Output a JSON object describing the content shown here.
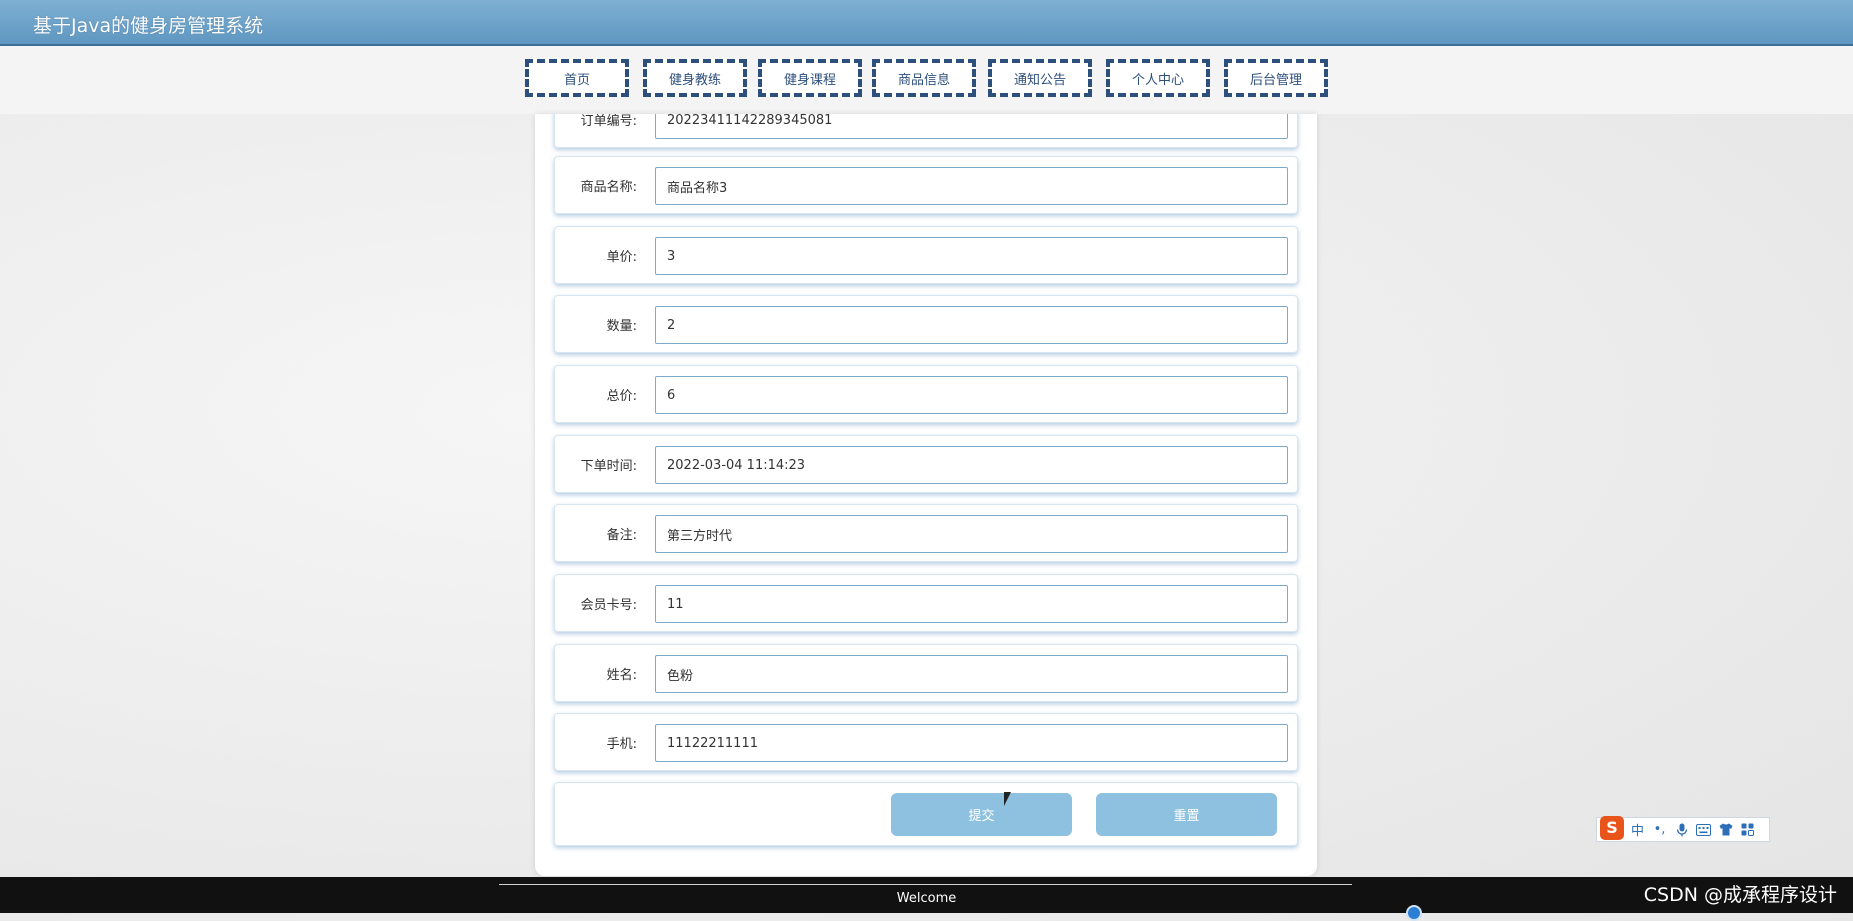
{
  "header": {
    "title": "基于Java的健身房管理系统"
  },
  "nav": {
    "items": [
      {
        "label": "首页"
      },
      {
        "label": "健身教练"
      },
      {
        "label": "健身课程"
      },
      {
        "label": "商品信息"
      },
      {
        "label": "通知公告"
      },
      {
        "label": "个人中心"
      },
      {
        "label": "后台管理"
      }
    ]
  },
  "form": {
    "fields": [
      {
        "label": "订单编号:",
        "value": "2022341114228934508​1"
      },
      {
        "label": "商品名称:",
        "value": "商品名称3"
      },
      {
        "label": "单价:",
        "value": "3"
      },
      {
        "label": "数量:",
        "value": "2"
      },
      {
        "label": "总价:",
        "value": "6"
      },
      {
        "label": "下单时间:",
        "value": "2022-03-04 11:14:23"
      },
      {
        "label": "备注:",
        "value": "第三方时代"
      },
      {
        "label": "会员卡号:",
        "value": "11"
      },
      {
        "label": "姓名:",
        "value": "色粉"
      },
      {
        "label": "手机:",
        "value": "11122211111"
      }
    ],
    "submit_label": "提交",
    "reset_label": "重置"
  },
  "ime": {
    "logo": "S",
    "lang": "中",
    "punct": "•,",
    "icons": [
      "microphone-icon",
      "keyboard-icon",
      "shirt-icon",
      "grid-icon"
    ]
  },
  "footer": {
    "welcome": "Welcome"
  },
  "watermark": "CSDN @成承程序设计",
  "colors": {
    "header": "#5f97c1",
    "nav_border": "#2d4f7c",
    "button": "#8ec0df",
    "footer": "#111111"
  }
}
